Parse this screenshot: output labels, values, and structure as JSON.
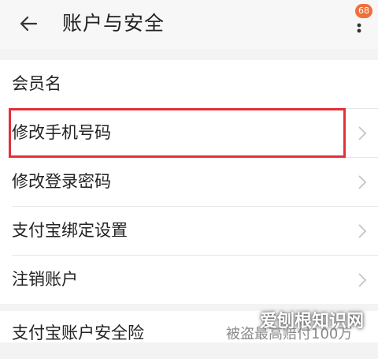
{
  "header": {
    "title": "账户与安全",
    "badge": "68"
  },
  "section1": {
    "items": [
      {
        "label": "会员名"
      },
      {
        "label": "修改手机号码"
      },
      {
        "label": "修改登录密码"
      },
      {
        "label": "支付宝绑定设置"
      },
      {
        "label": "注销账户"
      }
    ]
  },
  "section2": {
    "items": [
      {
        "label": "支付宝账户安全险",
        "value": "被盗最高赔付100万"
      }
    ]
  },
  "watermark": "爱刨根知识网",
  "colors": {
    "highlight": "#e4303a",
    "badge": "#f0703a"
  },
  "icons": [
    "back-arrow-icon",
    "more-vertical-icon",
    "chevron-right-icon"
  ]
}
